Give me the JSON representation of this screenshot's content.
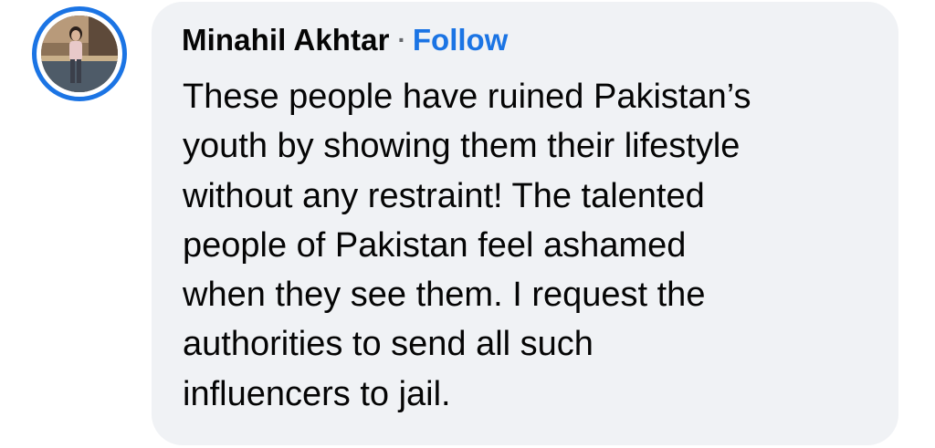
{
  "comment": {
    "author": {
      "name": "Minahil Akhtar",
      "avatar_icon": "profile-photo",
      "avatar_ring_color": "#1b74e4"
    },
    "separator": "·",
    "follow_label": "Follow",
    "text_lines": [
      "These people have ruined Pakistan’s",
      "youth by showing them their lifestyle",
      "without any restraint! The talented",
      "people of Pakistan feel ashamed",
      "when they see them. I request the",
      "authorities to send all such",
      "influencers to jail."
    ],
    "text": "These people have ruined Pakistan’s\nyouth by showing them their lifestyle\nwithout any restraint! The talented\npeople of Pakistan feel ashamed\nwhen they see them. I request the\nauthorities to send all such\ninfluencers to jail."
  },
  "colors": {
    "bubble_background": "#f0f2f5",
    "link": "#1b74e4",
    "text": "#050505",
    "secondary_text": "#65676b"
  }
}
